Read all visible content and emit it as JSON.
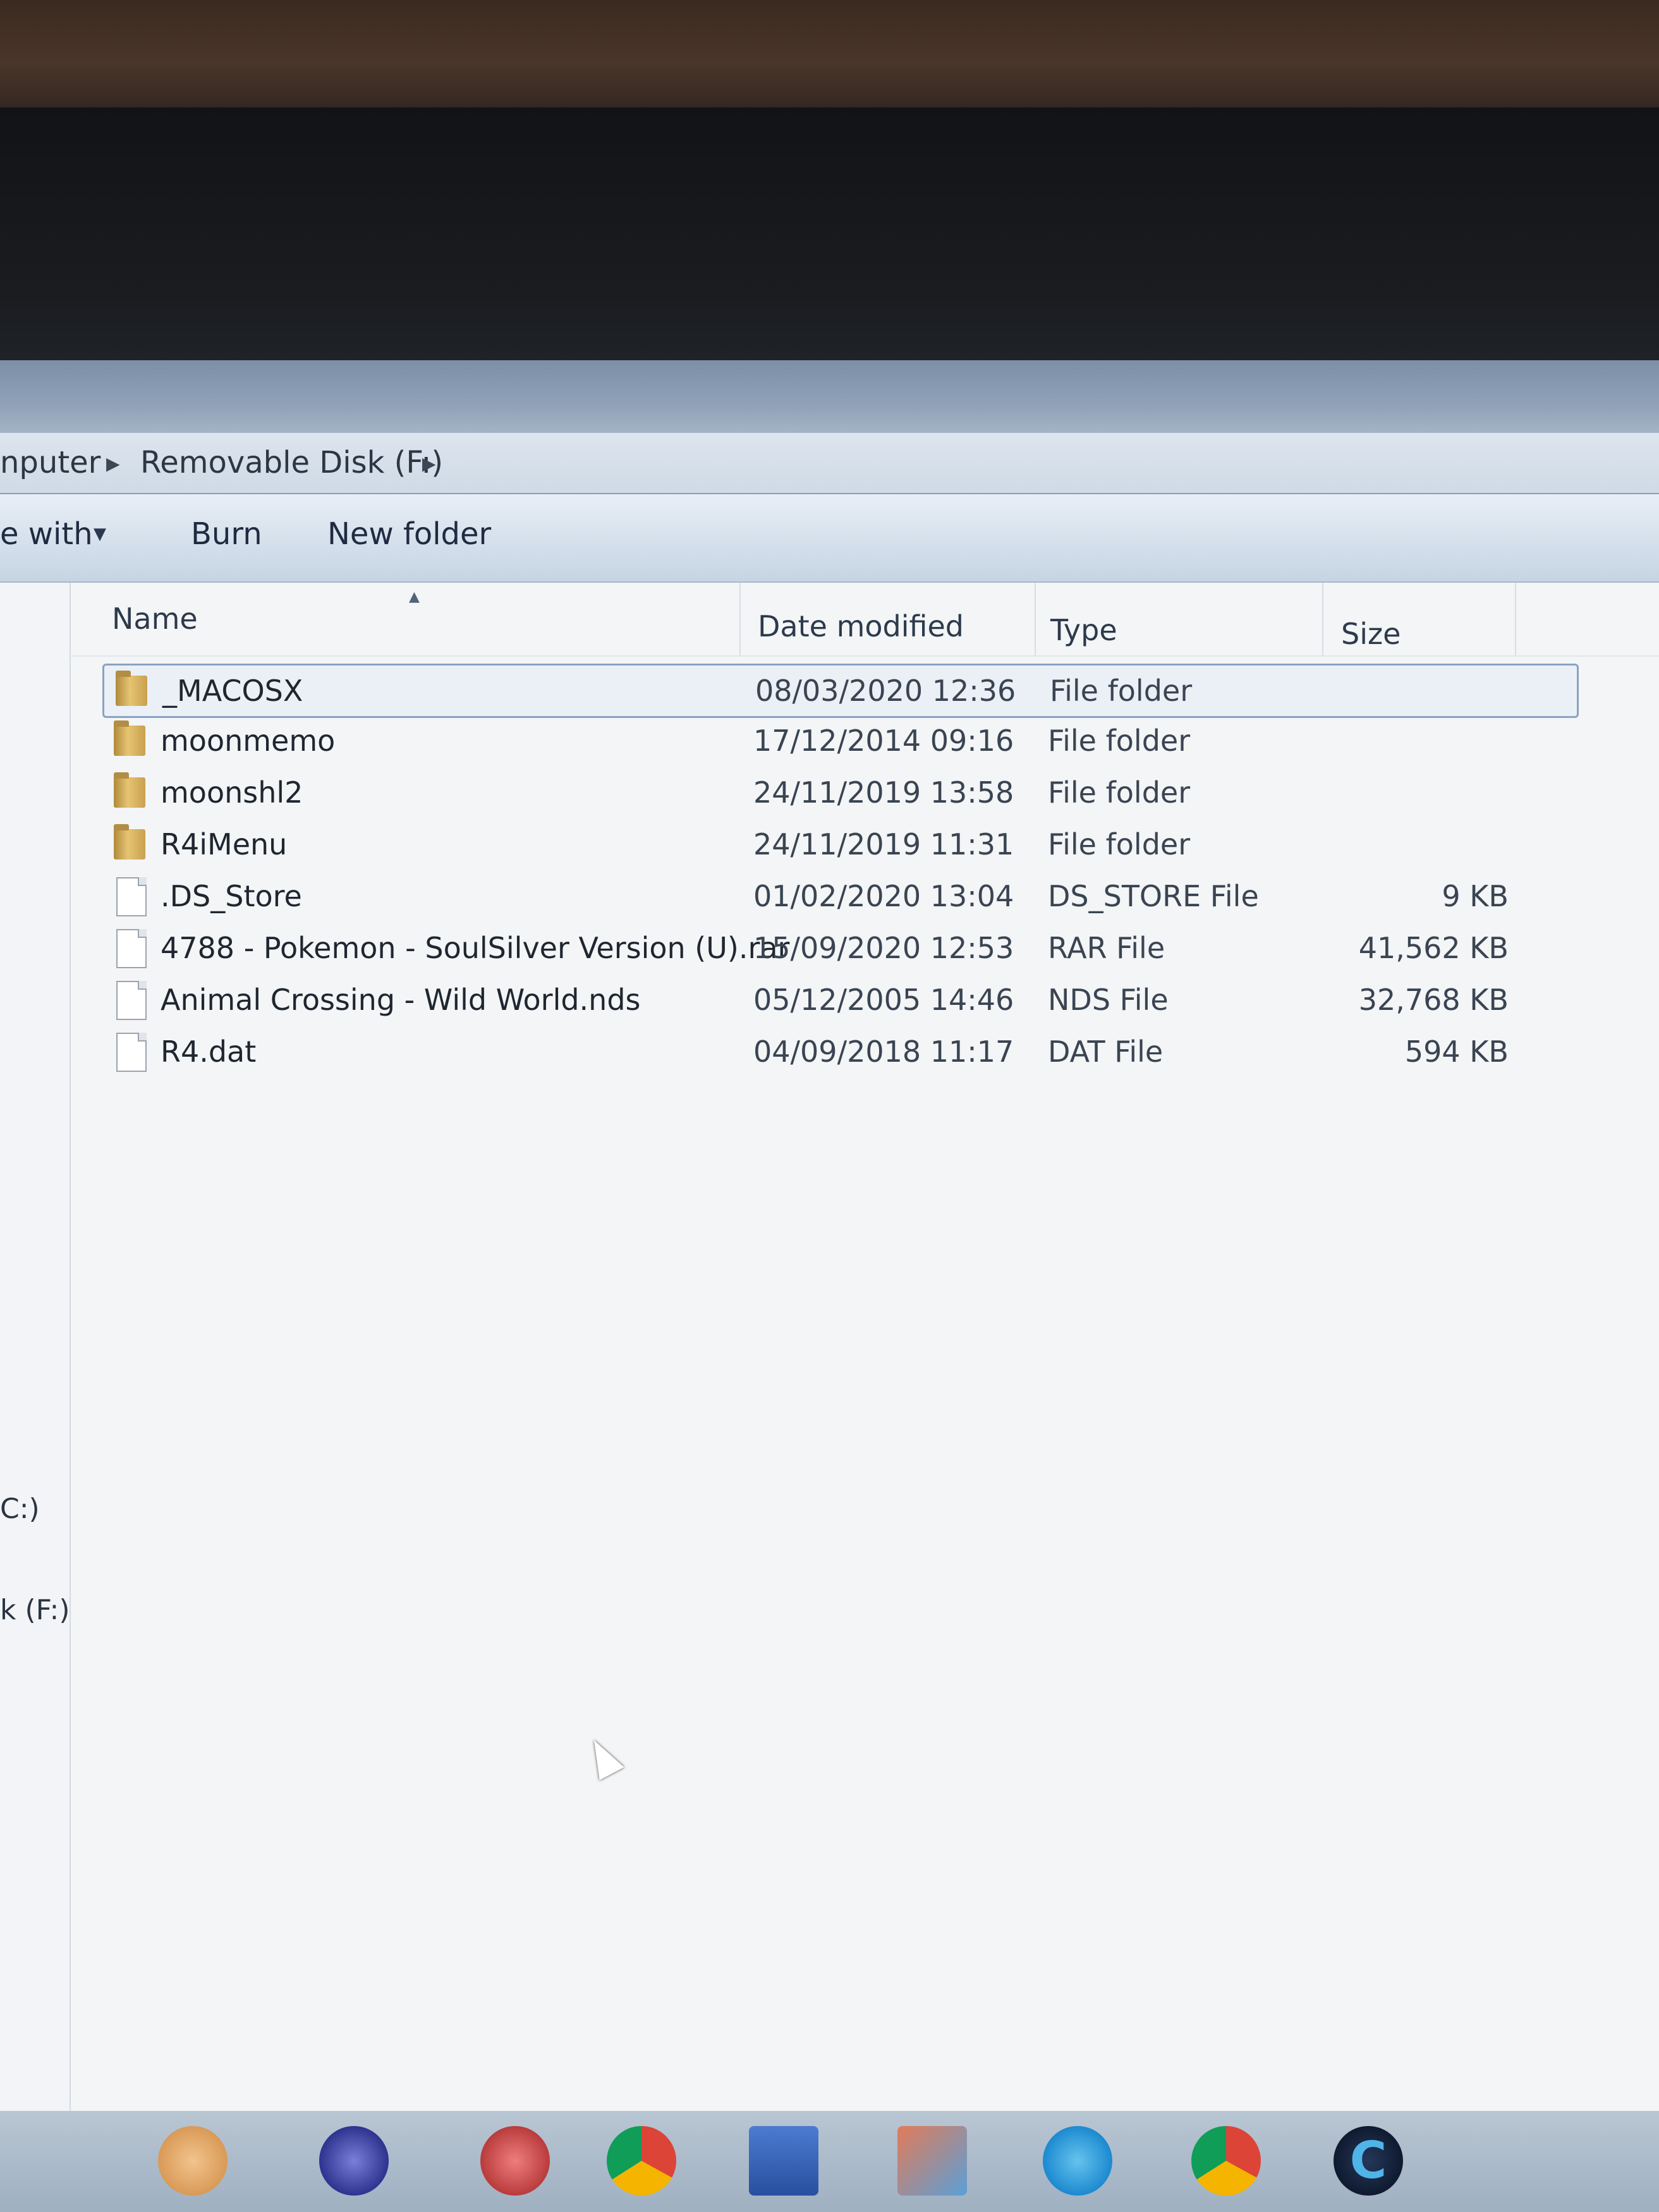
{
  "address": {
    "crumbs": [
      "nputer",
      "Removable Disk (F:)"
    ]
  },
  "toolbar": {
    "share_label": "e with",
    "burn_label": "Burn",
    "new_folder_label": "New folder"
  },
  "nav": {
    "items": [
      "C:)",
      "k (F:)"
    ]
  },
  "columns": {
    "name": "Name",
    "date": "Date modified",
    "type": "Type",
    "size": "Size"
  },
  "files": [
    {
      "name": "_MACOSX",
      "date": "08/03/2020 12:36",
      "type": "File folder",
      "size": "",
      "icon": "folder-icon"
    },
    {
      "name": "moonmemo",
      "date": "17/12/2014 09:16",
      "type": "File folder",
      "size": "",
      "icon": "folder-icon"
    },
    {
      "name": "moonshl2",
      "date": "24/11/2019 13:58",
      "type": "File folder",
      "size": "",
      "icon": "folder-icon"
    },
    {
      "name": "R4iMenu",
      "date": "24/11/2019 11:31",
      "type": "File folder",
      "size": "",
      "icon": "folder-icon"
    },
    {
      "name": ".DS_Store",
      "date": "01/02/2020 13:04",
      "type": "DS_STORE File",
      "size": "9 KB",
      "icon": "file-icon"
    },
    {
      "name": "4788 - Pokemon - SoulSilver Version (U).rar",
      "date": "15/09/2020 12:53",
      "type": "RAR File",
      "size": "41,562 KB",
      "icon": "file-icon"
    },
    {
      "name": "Animal Crossing - Wild World.nds",
      "date": "05/12/2005 14:46",
      "type": "NDS File",
      "size": "32,768 KB",
      "icon": "file-icon"
    },
    {
      "name": "R4.dat",
      "date": "04/09/2018 11:17",
      "type": "DAT File",
      "size": "594 KB",
      "icon": "file-icon"
    }
  ],
  "taskbar": {
    "ccleaner_glyph": "C"
  }
}
